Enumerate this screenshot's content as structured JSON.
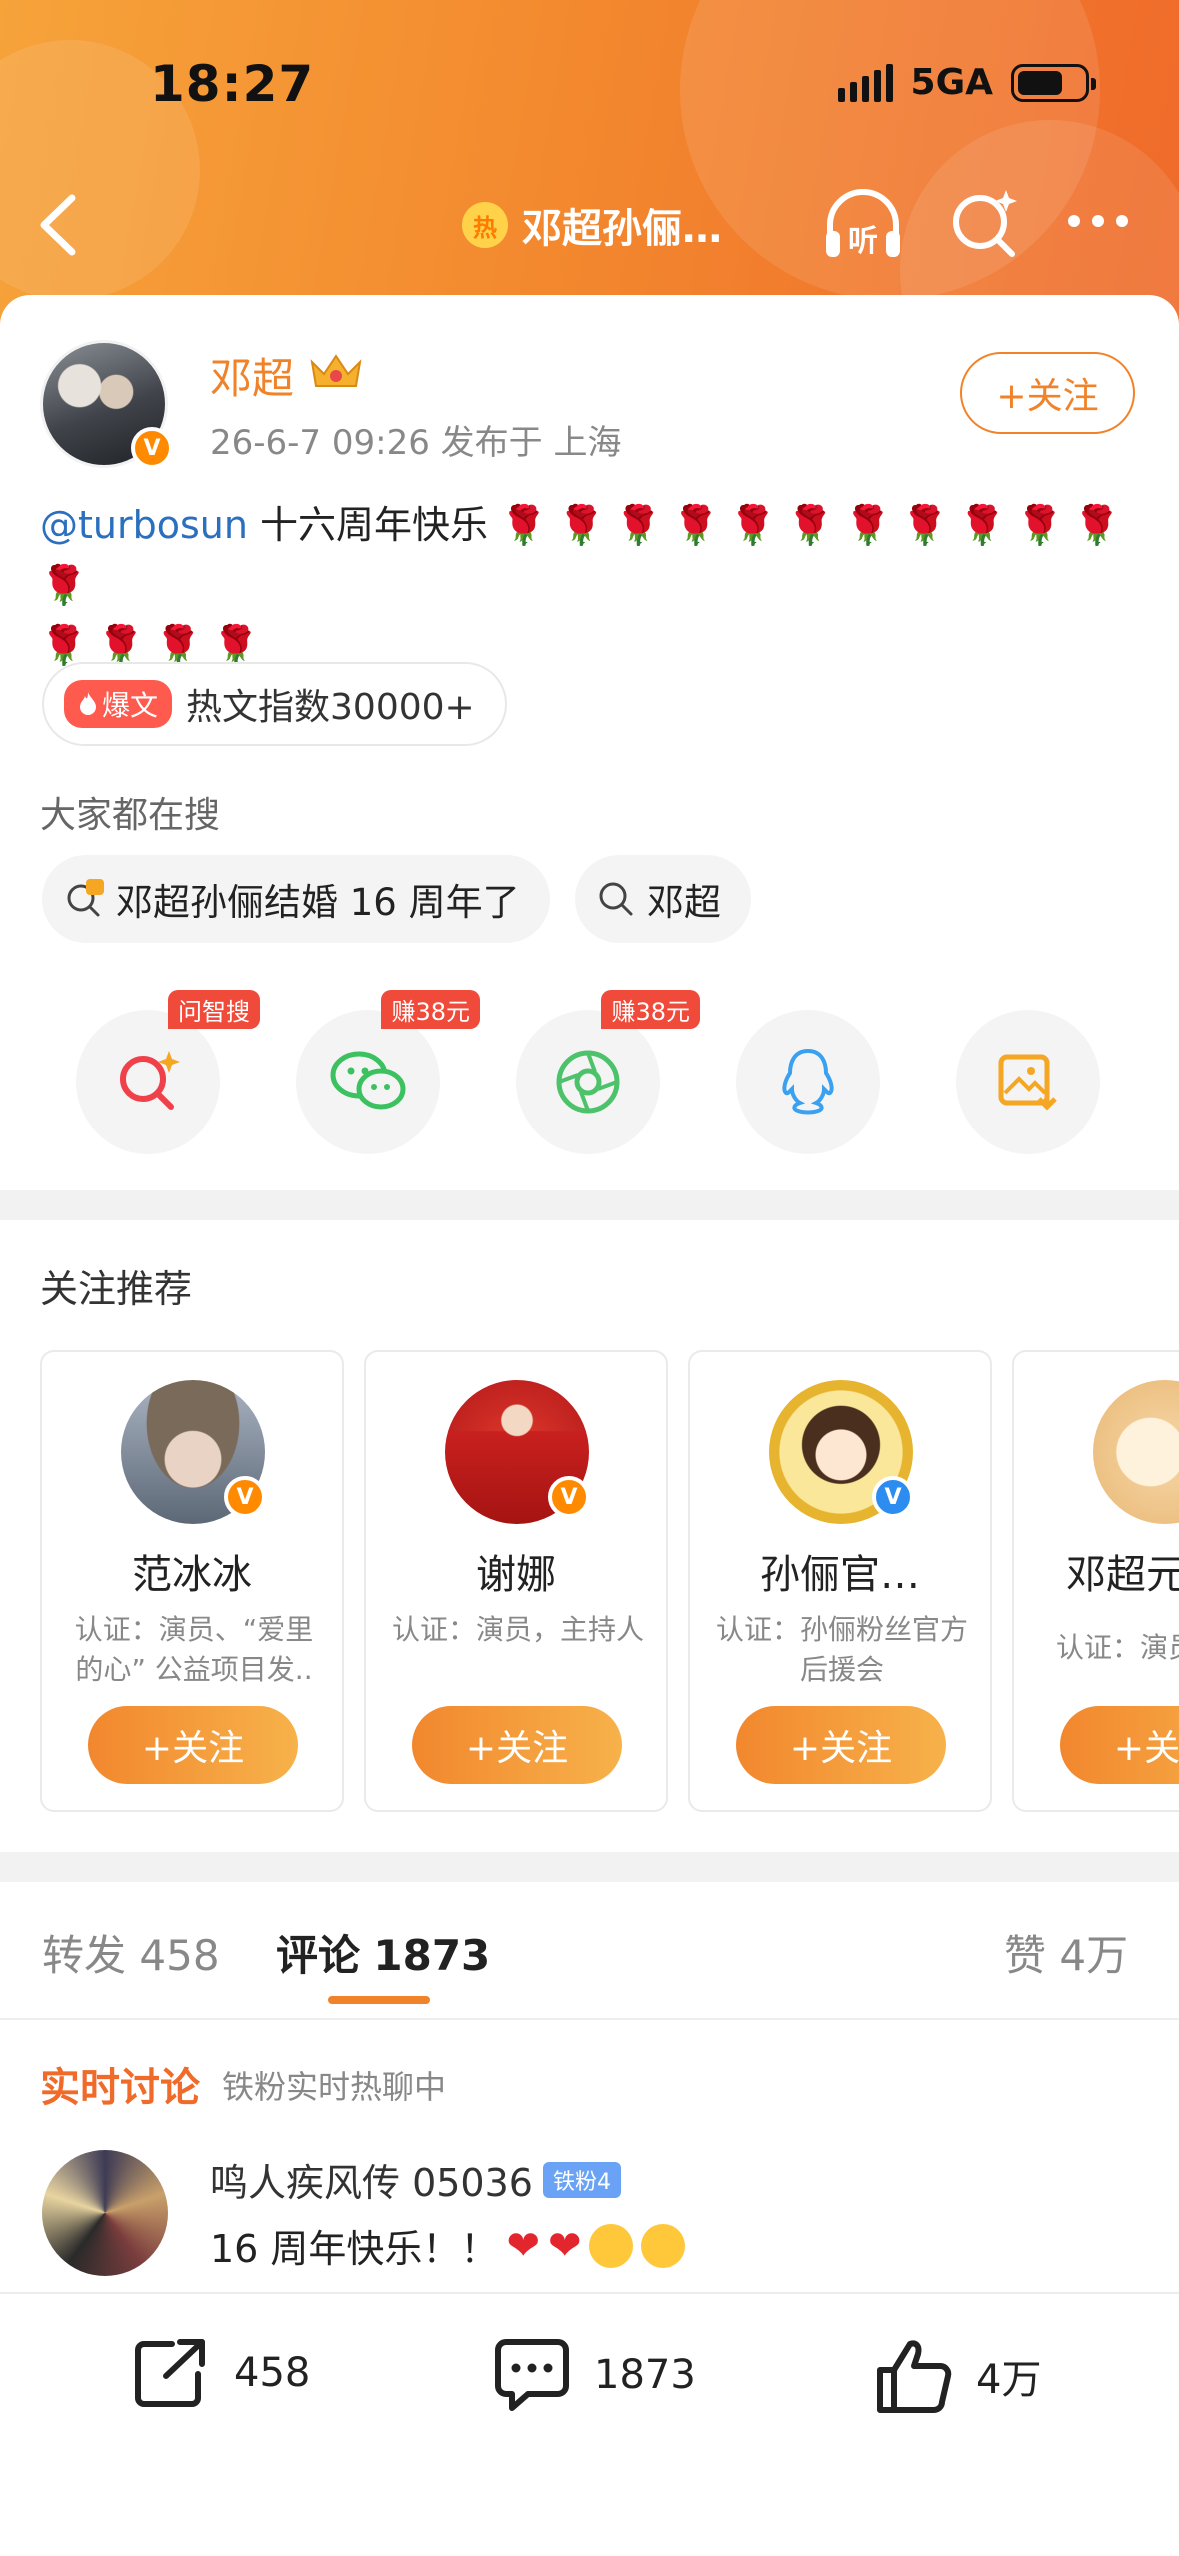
{
  "status_bar": {
    "time": "18:27",
    "network": "5GA"
  },
  "nav": {
    "title": "邓超孙俪…",
    "hot_badge": "热"
  },
  "post": {
    "author": "邓超",
    "meta": "26-6-7 09:26  发布于 上海",
    "follow_label": "+关注",
    "mention": "@turbosun",
    "text": " 十六周年快乐 ",
    "roses_line1": "🌹🌹🌹🌹🌹🌹🌹🌹🌹🌹🌹🌹",
    "roses_line2": "🌹🌹🌹🌹",
    "hot_badge": "爆文",
    "hot_index": "热文指数30000+"
  },
  "search": {
    "title": "大家都在搜",
    "chips": [
      "邓超孙俪结婚 16 周年了",
      "邓超"
    ]
  },
  "share": {
    "tags": [
      "问智搜",
      "赚38元",
      "赚38元"
    ]
  },
  "recommend": {
    "title": "关注推荐",
    "cards": [
      {
        "name": "范冰冰",
        "desc": "认证：演员、“爱里的心” 公益项目发..",
        "follow": "+关注"
      },
      {
        "name": "谢娜",
        "desc": "认证：演员，主持人",
        "follow": "+关注"
      },
      {
        "name": "孙俪官…",
        "desc": "认证：孙俪粉丝官方后援会",
        "follow": "+关注"
      },
      {
        "name": "邓超元",
        "desc": "认证：演员",
        "follow": "+关注"
      }
    ]
  },
  "tabs": {
    "repost_label": "转发",
    "repost_count": "458",
    "comment_label": "评论",
    "comment_count": "1873",
    "like_label": "赞",
    "like_count": "4万"
  },
  "live": {
    "title": "实时讨论",
    "subtitle": "铁粉实时热聊中"
  },
  "comment": {
    "user": "鸣人疾风传 05036",
    "badge": "铁粉4",
    "text": "16 周年快乐！！"
  },
  "bottom_bar": {
    "repost": "458",
    "comment": "1873",
    "like": "4万"
  }
}
